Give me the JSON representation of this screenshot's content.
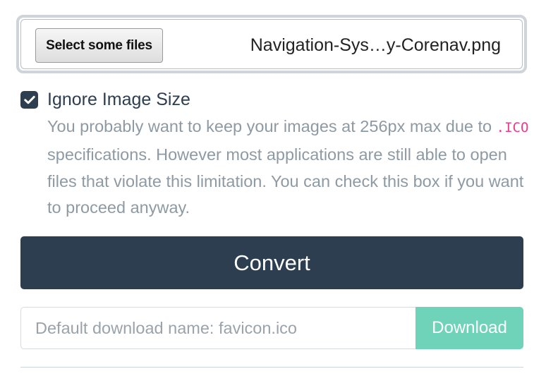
{
  "file_picker": {
    "button_label": "Select some files",
    "selected_file": "Navigation-Sys…y-Corenav.png"
  },
  "ignore_size": {
    "checked": true,
    "label": "Ignore Image Size",
    "help_before": "You probably want to keep your images at 256px max due to ",
    "help_code": ".ICO",
    "help_after": " specifications. However most applications are still able to open files that violate this limitation. You can check this box if you want to proceed anyway."
  },
  "convert": {
    "label": "Convert"
  },
  "download": {
    "input_value": "",
    "placeholder": "Default download name: favicon.ico",
    "button_label": "Download"
  },
  "icons": {
    "checkbox": "check-icon"
  },
  "colors": {
    "primary": "#2c3e50",
    "accent": "#6fd3b9",
    "muted_text": "#8e9aa3",
    "code": "#e83e8c"
  }
}
